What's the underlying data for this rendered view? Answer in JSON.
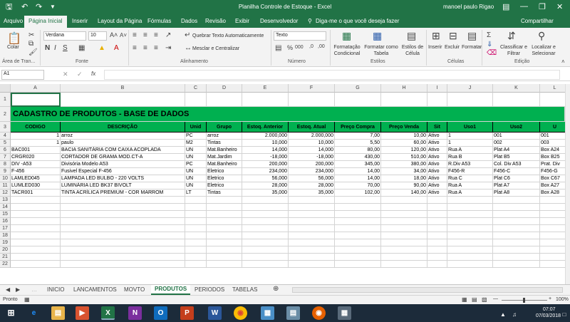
{
  "titlebar": {
    "title": "Planilha Controle de Estoque - Excel",
    "user": "manoel paulo Rigao"
  },
  "tabs": [
    "Arquivo",
    "Página Inicial",
    "Inserir",
    "Layout da Página",
    "Fórmulas",
    "Dados",
    "Revisão",
    "Exibir",
    "Desenvolvedor"
  ],
  "tell_me": "Diga-me o que você deseja fazer",
  "share": "Compartilhar",
  "ribbon": {
    "paste": "Colar",
    "clipboard": "Área de Tran...",
    "font_name": "Verdana",
    "font_size": "10",
    "font_group": "Fonte",
    "wrap_text": "Quebrar Texto Automaticamente",
    "merge_center": "Mesclar e Centralizar",
    "alignment_group": "Alinhamento",
    "number_format": "Texto",
    "number_group": "Número",
    "conditional": "Formatação Condicional",
    "format_table": "Formatar como Tabela",
    "cell_styles": "Estilos de Célula",
    "styles_group": "Estilos",
    "insert": "Inserir",
    "delete": "Excluir",
    "format": "Formatar",
    "cells_group": "Células",
    "sort_filter": "Classificar e Filtrar",
    "find_select": "Localizar e Selecionar",
    "editing_group": "Edição"
  },
  "formula_bar": {
    "name_box": "A1",
    "fx": "fx",
    "value": ""
  },
  "columns": [
    "A",
    "B",
    "C",
    "D",
    "E",
    "F",
    "G",
    "H",
    "I",
    "J",
    "K",
    "L"
  ],
  "sheet_title": "CADASTRO DE PRODUTOS  - BASE DE DADOS",
  "headers": [
    "CODIGO",
    "DESCRIÇÃO",
    "Unid",
    "Grupo",
    "Estoq. Anterior",
    "Estoq. Atual",
    "Preço Compra",
    "Preço Venda",
    "Sit",
    "Uso1",
    "Uso2",
    "U"
  ],
  "rows": [
    [
      "1",
      "arroz",
      "PC",
      "arroz",
      "2.000,000",
      "2.000,000",
      "7,00",
      "10,00",
      "Ativo",
      "1",
      "001",
      "001"
    ],
    [
      "1",
      "paulo",
      "M2",
      "Tintas",
      "10,000",
      "10,000",
      "5,50",
      "60,00",
      "Ativo",
      "1",
      "002",
      "003"
    ],
    [
      "BAC001",
      "BACIA SANITÁRIA COM CAIXA ACOPLADA",
      "UN",
      "Mat.Banheiro",
      "14,000",
      "14,000",
      "80,00",
      "120,00",
      "Ativo",
      "Rua A",
      "Plat A4",
      "Box A24"
    ],
    [
      "CRGR020",
      "CORTADOR DE GRAMA MOD.CT-A",
      "UN",
      "Mat.Jardim",
      "-18,000",
      "-18,000",
      "430,00",
      "510,00",
      "Ativo",
      "Rua B",
      "Plat B5",
      "Box B25"
    ],
    [
      "DIV -A53",
      "Divisória Modelo A53",
      "PC",
      "Mat.Banheiro",
      "200,000",
      "200,000",
      "345,00",
      "380,00",
      "Ativo",
      "R.Div A53",
      "Col. Div A53",
      "Prat. Div"
    ],
    [
      "F-456",
      "Fusivel Especial F-456",
      "UN",
      "Eletrico",
      "234,000",
      "234,000",
      "14,00",
      "34,00",
      "Ativo",
      "F456-R",
      "F456-C",
      "F456-G"
    ],
    [
      "LAMLED045",
      "LAMPADA LED BULBO - 220  VOLTS",
      "UN",
      "Eletrico",
      "56,000",
      "56,000",
      "14,00",
      "18,00",
      "Ativo",
      "Rua C",
      "Plat C6",
      "Box C67"
    ],
    [
      "LUMLED030",
      "LUMINÁRIA LED BK37 BIVOLT",
      "UN",
      "Eletrico",
      "28,000",
      "28,000",
      "70,00",
      "90,00",
      "Ativo",
      "Rua A",
      "Plat A7",
      "Box A27"
    ],
    [
      "TACR001",
      "TINTA ACRÍLICA PREMIUM - COR MARROM",
      "LT",
      "Tintas",
      "35,000",
      "35,000",
      "102,00",
      "140,00",
      "Ativo",
      "Rua A",
      "Plat A8",
      "Box A28"
    ]
  ],
  "row_numbers": [
    "1",
    "2",
    "3",
    "4",
    "5",
    "6",
    "7",
    "8",
    "9",
    "10",
    "11",
    "12",
    "13",
    "14",
    "15",
    "16",
    "17",
    "18",
    "19",
    "20",
    "21",
    "22"
  ],
  "sheet_tabs": [
    "INICIO",
    "LANCAMENTOS",
    "MOVTO",
    "PRODUTOS",
    "PERIODOS",
    "TABELAS"
  ],
  "active_sheet": "PRODUTOS",
  "status": {
    "mode": "Pronto",
    "zoom": "100%"
  },
  "taskbar": {
    "time": "07:07",
    "date": "07/03/2018"
  },
  "colors": {
    "excel_green": "#217346",
    "header_green": "#00b050"
  }
}
